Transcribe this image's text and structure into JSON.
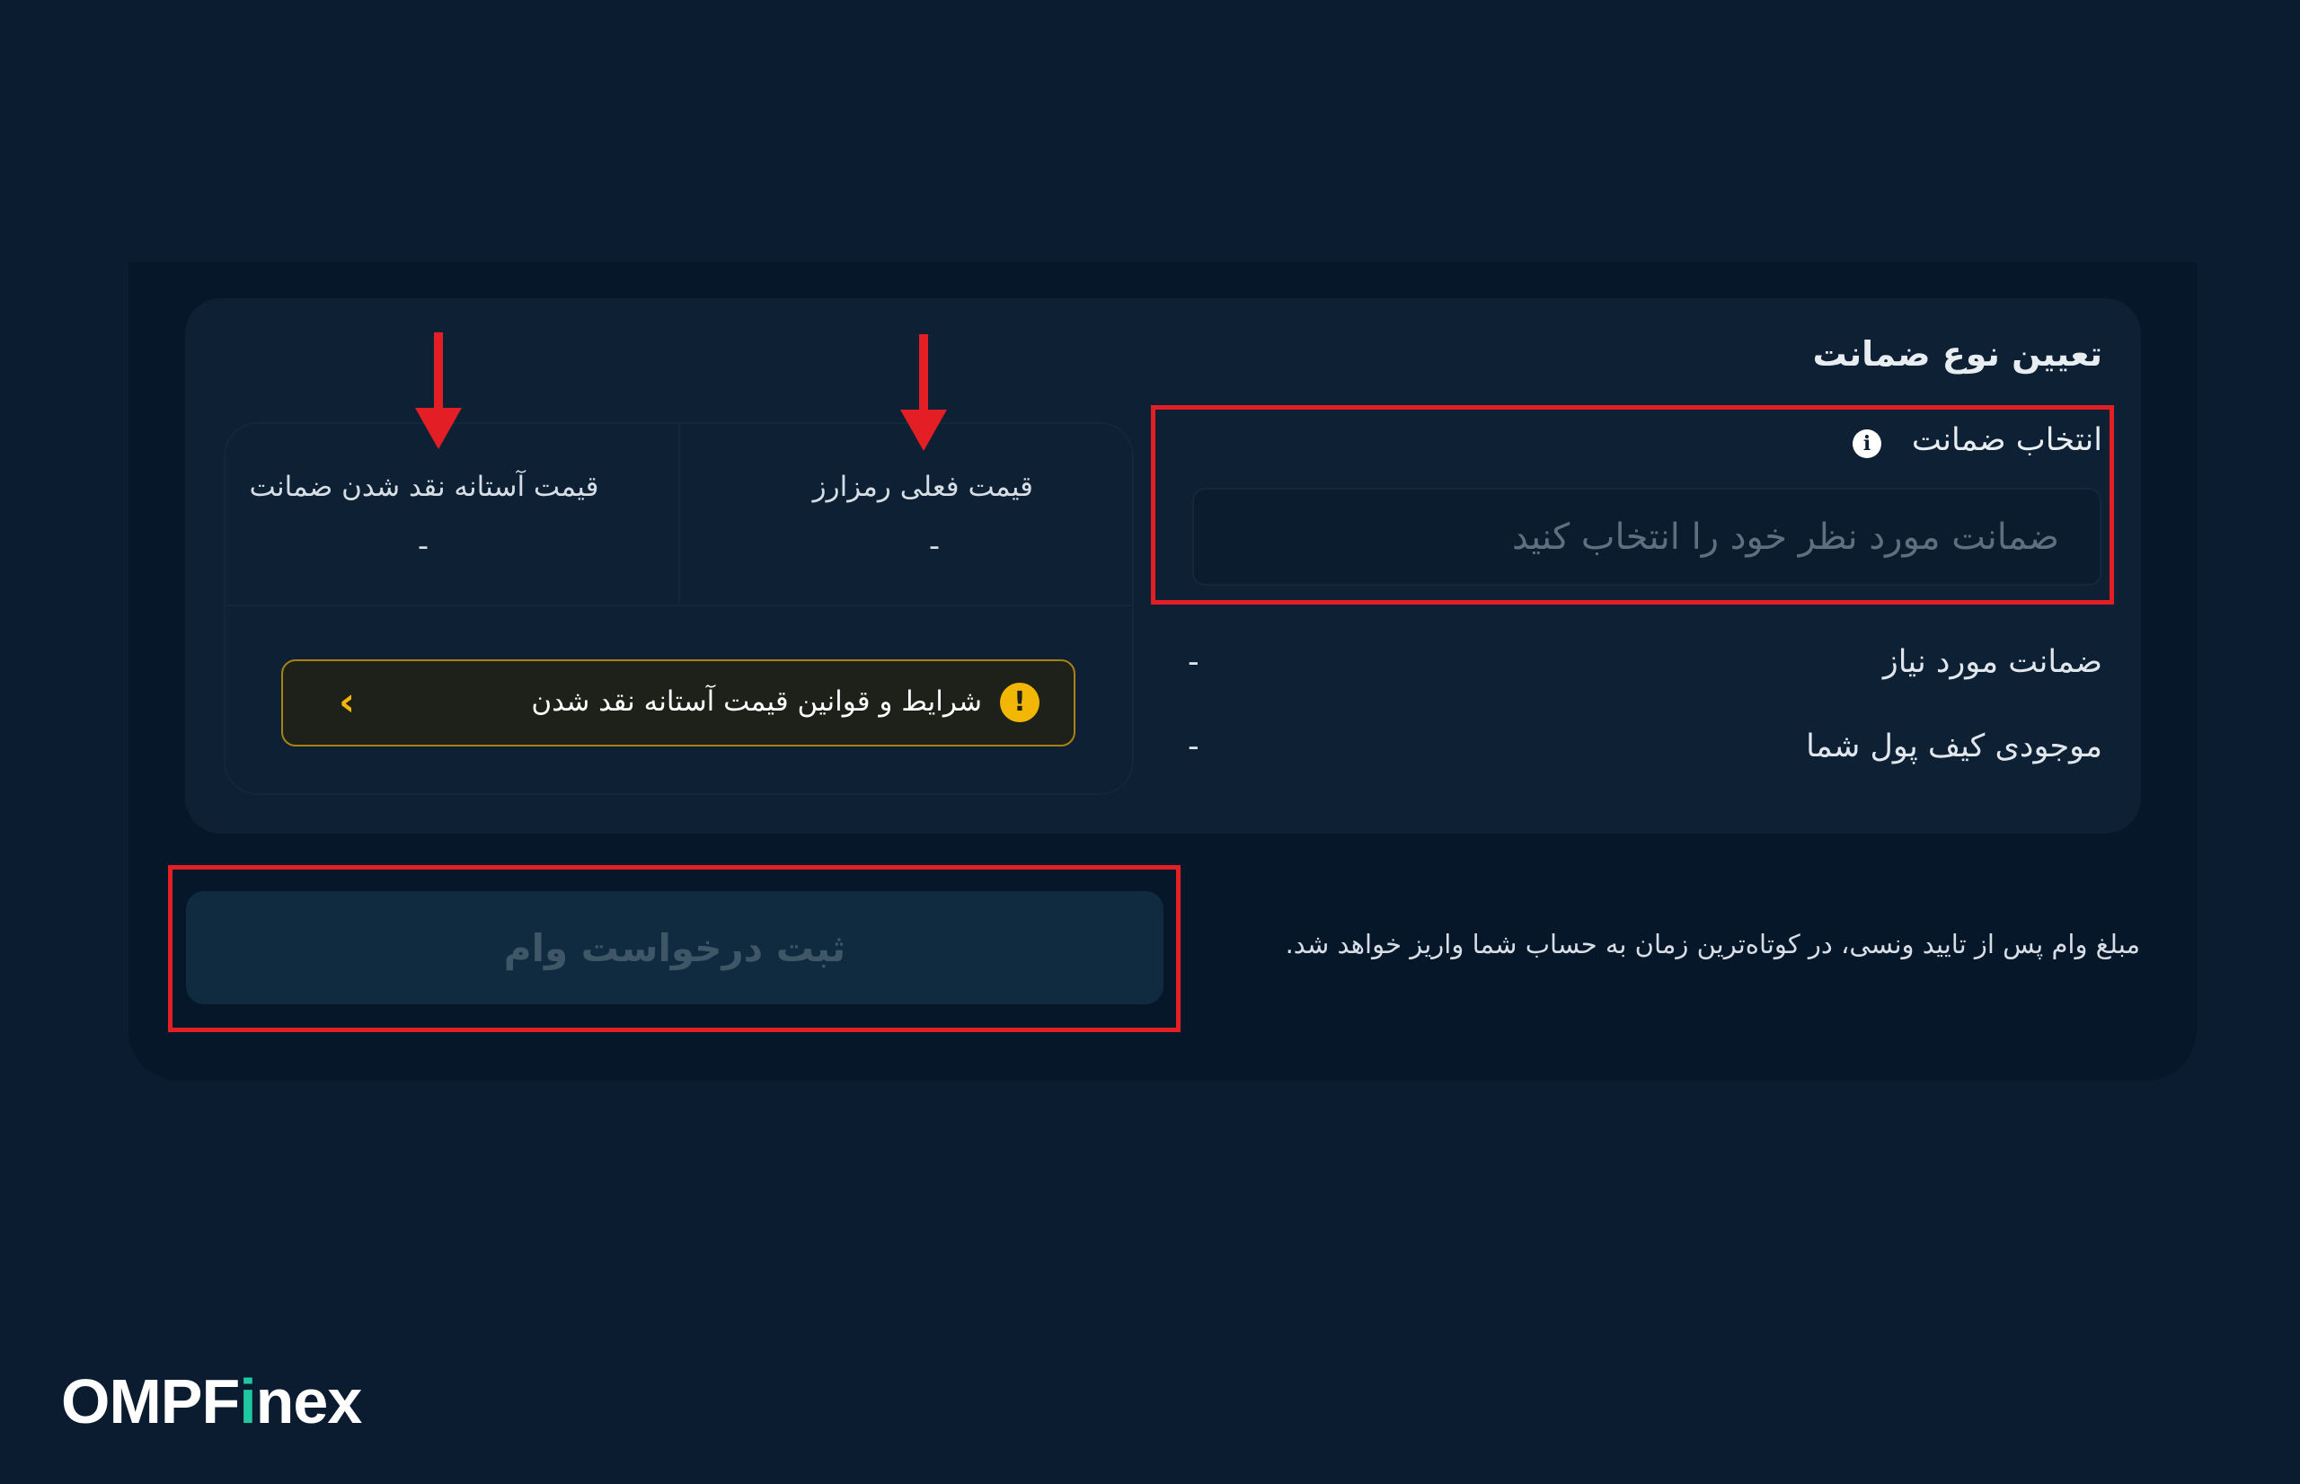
{
  "colors": {
    "background": "#0b1c30",
    "panel": "#06172a",
    "card": "#0d2034",
    "highlight": "#e31e24",
    "warning": "#f2b705",
    "logo_accent": "#1ec8a0"
  },
  "collateral": {
    "title": "تعیین نوع ضمانت",
    "select_label": "انتخاب ضمانت",
    "info_icon": "info-icon",
    "placeholder": "ضمانت مورد نظر خود را انتخاب کنید",
    "required_label": "ضمانت مورد نیاز",
    "required_value": "-",
    "wallet_label": "موجودی کیف پول شما",
    "wallet_value": "-"
  },
  "prices": {
    "current_label": "قیمت فعلی رمزارز",
    "current_value": "-",
    "liquidation_label": "قیمت آستانه نقد شدن ضمانت",
    "liquidation_value": "-"
  },
  "warning": {
    "text": "شرایط و قوانین قیمت آستانه نقد شدن",
    "icon": "exclamation-icon",
    "chevron": "chevron-left-icon"
  },
  "submit": {
    "label": "ثبت درخواست وام"
  },
  "note": "مبلغ وام پس از تایید ونسی، در کوتاه‌ترین زمان به حساب شما واریز خواهد شد.",
  "logo": {
    "part1": "OMPF",
    "accent": "i",
    "part2": "nex"
  }
}
